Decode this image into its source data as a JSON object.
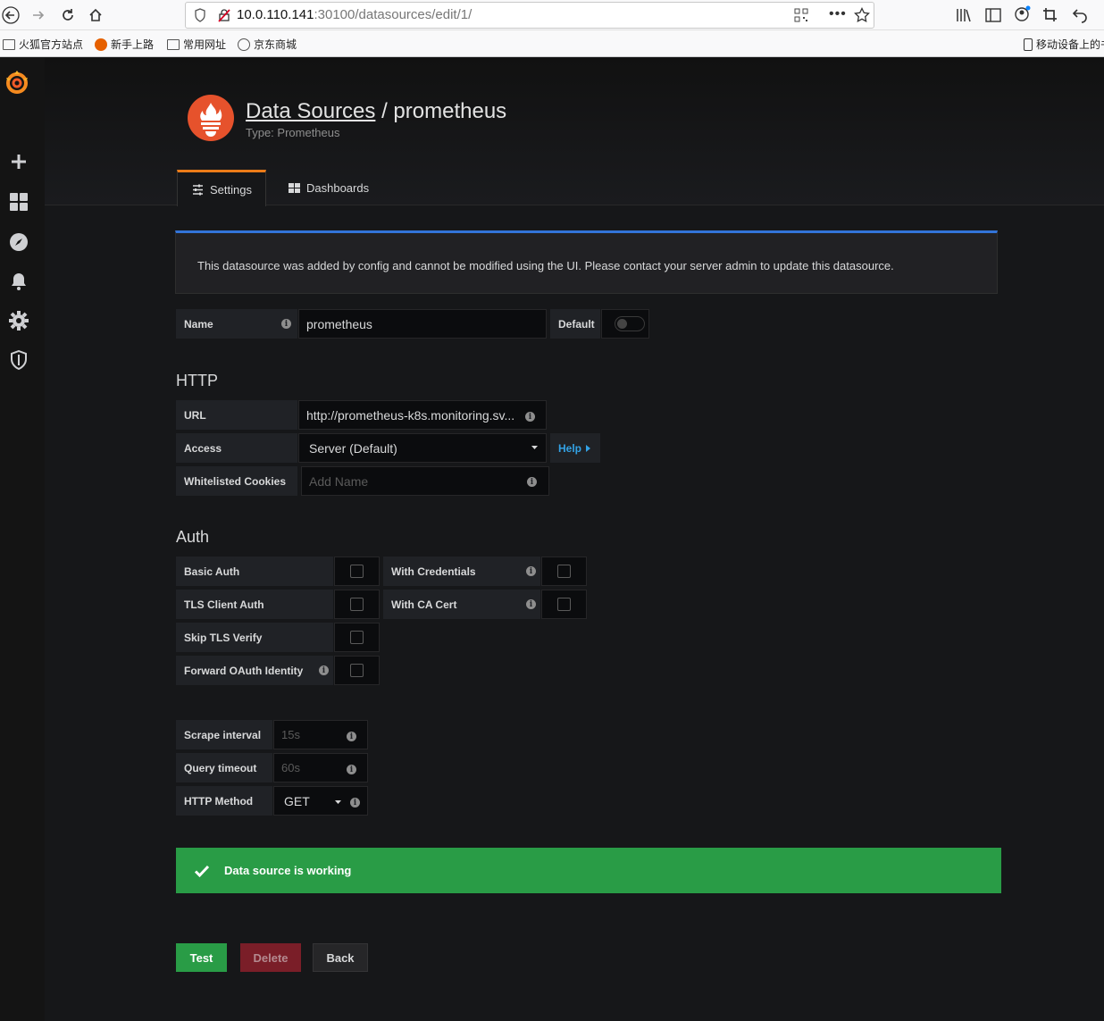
{
  "browser": {
    "url_host": "10.0.110.141",
    "url_path": ":30100/datasources/edit/1/",
    "bookmarks": [
      "火狐官方站点",
      "新手上路",
      "常用网址",
      "京东商城"
    ],
    "mobile_bookmark": "移动设备上的书签"
  },
  "header": {
    "breadcrumb_link": "Data Sources",
    "separator": " / ",
    "title": "prometheus",
    "subtitle": "Type: Prometheus"
  },
  "tabs": [
    {
      "label": "Settings",
      "active": true
    },
    {
      "label": "Dashboards",
      "active": false
    }
  ],
  "alert": {
    "message": "This datasource was added by config and cannot be modified using the UI. Please contact your server admin to update this datasource."
  },
  "basic": {
    "name_label": "Name",
    "name_value": "prometheus",
    "default_label": "Default"
  },
  "http": {
    "heading": "HTTP",
    "url_label": "URL",
    "url_value": "http://prometheus-k8s.monitoring.sv...",
    "access_label": "Access",
    "access_value": "Server (Default)",
    "help_label": "Help",
    "cookies_label": "Whitelisted Cookies",
    "cookies_placeholder": "Add Name"
  },
  "auth": {
    "heading": "Auth",
    "basic_auth": "Basic Auth",
    "with_credentials": "With Credentials",
    "tls_client_auth": "TLS Client Auth",
    "with_ca_cert": "With CA Cert",
    "skip_tls": "Skip TLS Verify",
    "forward_oauth": "Forward OAuth Identity"
  },
  "prom": {
    "scrape_label": "Scrape interval",
    "scrape_placeholder": "15s",
    "timeout_label": "Query timeout",
    "timeout_placeholder": "60s",
    "method_label": "HTTP Method",
    "method_value": "GET"
  },
  "status": {
    "message": "Data source is working"
  },
  "buttons": {
    "test": "Test",
    "delete": "Delete",
    "back": "Back"
  },
  "colors": {
    "success": "#299c46",
    "danger": "#b22e3a",
    "info_border": "#3274d9",
    "tab_accent": "#eb7b18",
    "prometheus_brand": "#e6522c"
  }
}
